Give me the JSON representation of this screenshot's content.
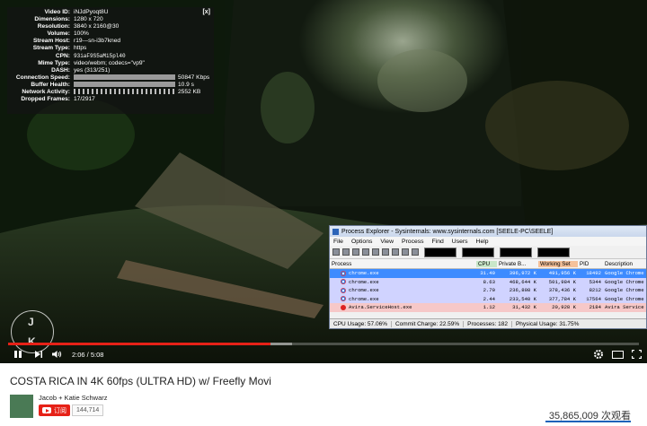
{
  "stats": {
    "close_label": "[x]",
    "rows": [
      {
        "k": "Video ID:",
        "v": "iNJdPyoqt8U"
      },
      {
        "k": "Dimensions:",
        "v": "1280 x 720"
      },
      {
        "k": "Resolution:",
        "v": "3840 x 2160@30"
      },
      {
        "k": "Volume:",
        "v": "100%"
      },
      {
        "k": "Stream Host:",
        "v": "r19---sn-i3b7kned"
      },
      {
        "k": "Stream Type:",
        "v": "https"
      },
      {
        "k": "CPN:",
        "v": "93iaF9S5aMi5pl40"
      },
      {
        "k": "Mime Type:",
        "v": "video/webm; codecs=\"vp9\""
      },
      {
        "k": "DASH:",
        "v": "yes (313/251)"
      },
      {
        "k": "Connection Speed:",
        "v": "50847 Kbps"
      },
      {
        "k": "Buffer Health:",
        "v": "10.9 s"
      },
      {
        "k": "Network Activity:",
        "v": "2552 KB"
      },
      {
        "k": "Dropped Frames:",
        "v": "17/2917"
      }
    ]
  },
  "watermark": {
    "letters": [
      "J",
      "K"
    ]
  },
  "player": {
    "progress_fraction": 0.416,
    "time": "2:06 / 5:08"
  },
  "process_explorer": {
    "title": "Process Explorer - Sysinternals: www.sysinternals.com [SEELE-PC\\SEELE]",
    "menu": [
      "File",
      "Options",
      "View",
      "Process",
      "Find",
      "Users",
      "Help"
    ],
    "columns": [
      "Process",
      "CPU",
      "Private B...",
      "Working Set",
      "PID",
      "Description"
    ],
    "rows": [
      {
        "name": "chrome.exe",
        "cpu": "31.40",
        "pb": "396,972 K",
        "ws": "491,956 K",
        "pid": "18492",
        "desc": "Google Chrome"
      },
      {
        "name": "chrome.exe",
        "cpu": "8.63",
        "pb": "468,644 K",
        "ws": "501,984 K",
        "pid": "5344",
        "desc": "Google Chrome"
      },
      {
        "name": "chrome.exe",
        "cpu": "2.70",
        "pb": "236,808 K",
        "ws": "378,436 K",
        "pid": "8212",
        "desc": "Google Chrome"
      },
      {
        "name": "chrome.exe",
        "cpu": "2.44",
        "pb": "233,540 K",
        "ws": "377,784 K",
        "pid": "17564",
        "desc": "Google Chrome"
      },
      {
        "name": "Avira.ServiceHost.exe",
        "cpu": "1.12",
        "pb": "31,432 K",
        "ws": "20,928 K",
        "pid": "2184",
        "desc": "Avira Service Host"
      }
    ],
    "status": {
      "cpu": "CPU Usage: 57.06%",
      "commit": "Commit Charge: 22.59%",
      "processes": "Processes: 182",
      "physical": "Physical Usage: 31.75%"
    }
  },
  "video": {
    "title": "COSTA RICA IN 4K 60fps (ULTRA HD) w/ Freefly Movi",
    "channel": "Jacob + Katie Schwarz",
    "subscribe_label": "订阅",
    "subscriber_count": "144,714",
    "views": "35,865,009 次观看"
  }
}
